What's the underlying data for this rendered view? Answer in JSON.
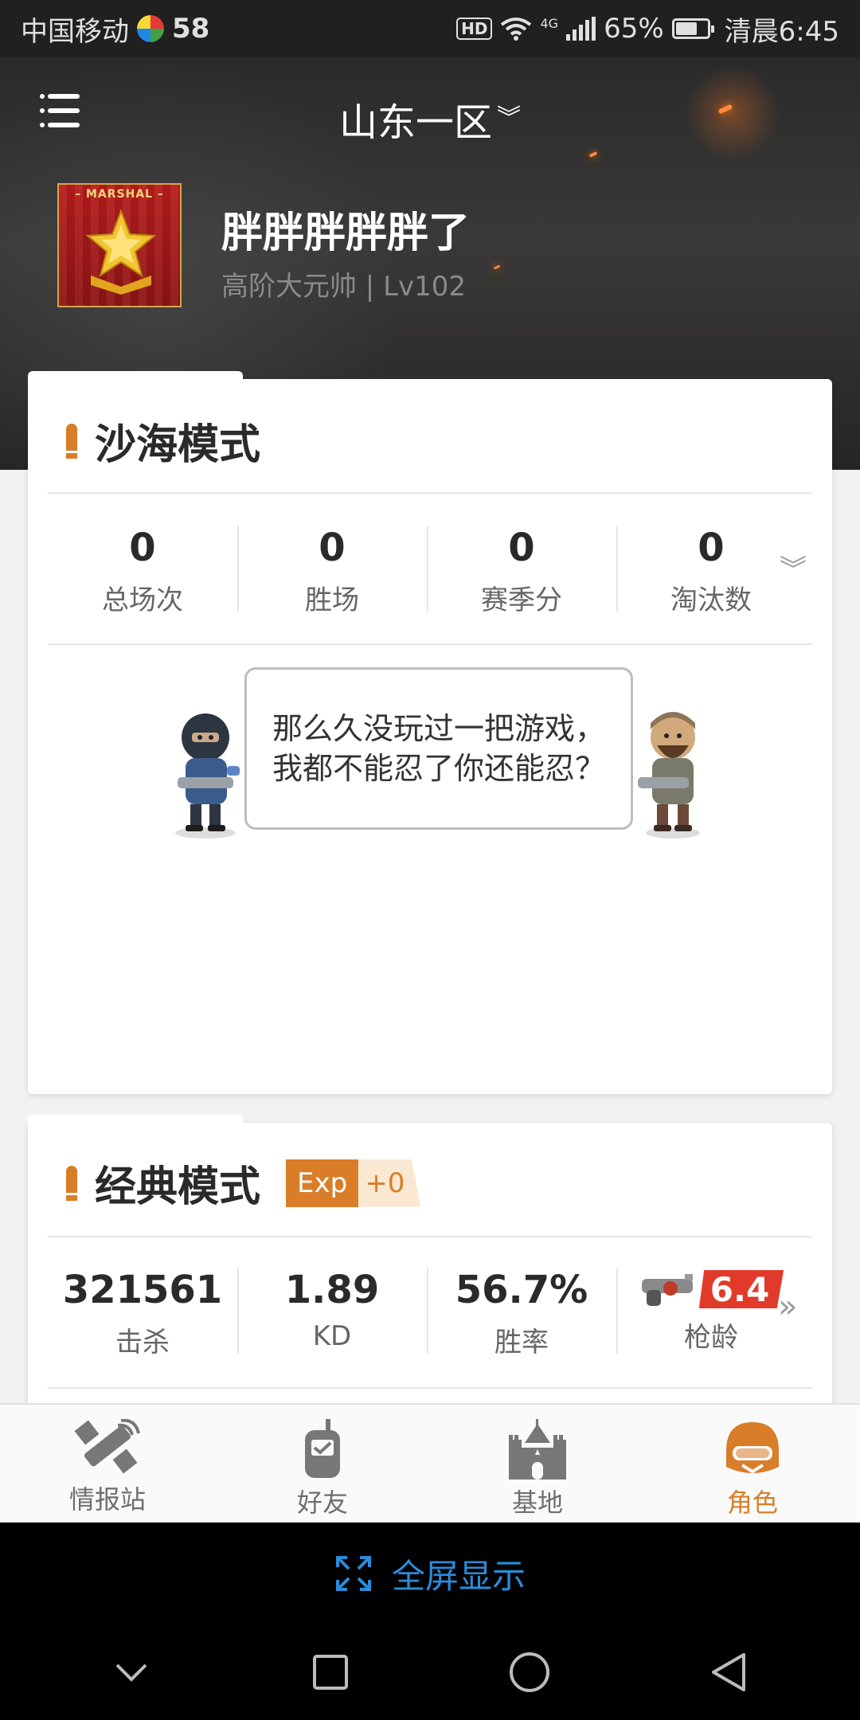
{
  "status_bar": {
    "carrier": "中国移动",
    "carrier_badge": "58",
    "hd": "HD",
    "network": "4G",
    "battery": "65%",
    "time": "清晨6:45"
  },
  "header": {
    "server": "山东一区",
    "badge_text": "– MARSHAL –",
    "player_name": "胖胖胖胖胖了",
    "player_rank": "高阶大元帅 | Lv102"
  },
  "desert_mode": {
    "title": "沙海模式",
    "stats": [
      {
        "value": "0",
        "label": "总场次"
      },
      {
        "value": "0",
        "label": "胜场"
      },
      {
        "value": "0",
        "label": "赛季分"
      },
      {
        "value": "0",
        "label": "淘汰数"
      }
    ],
    "empty_message": "那么久没玩过一把游戏，我都不能忍了你还能忍？"
  },
  "classic_mode": {
    "title": "经典模式",
    "exp_label": "Exp",
    "exp_value": "+0",
    "stats": [
      {
        "value": "321561",
        "label": "击杀"
      },
      {
        "value": "1.89",
        "label": "KD"
      },
      {
        "value": "56.7%",
        "label": "胜率"
      }
    ],
    "gun_age_value": "6.4",
    "gun_age_label": "枪龄"
  },
  "tabs": [
    {
      "label": "情报站",
      "icon": "satellite-icon",
      "active": false
    },
    {
      "label": "好友",
      "icon": "walkie-talkie-icon",
      "active": false
    },
    {
      "label": "基地",
      "icon": "castle-icon",
      "active": false
    },
    {
      "label": "角色",
      "icon": "helmet-icon",
      "active": true
    }
  ],
  "fullscreen_label": "全屏显示",
  "colors": {
    "accent": "#d97d28",
    "link_blue": "#2b8bd9",
    "badge_red": "#e23a2a"
  }
}
